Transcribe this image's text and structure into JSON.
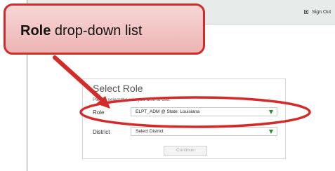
{
  "header": {
    "signout_label": "Sign Out"
  },
  "select_role": {
    "title": "Select Role",
    "instruction": "Please select the role you wish to use.",
    "role_label": "Role",
    "role_value": "ELPT_ADM @ State: Louisiana",
    "district_label": "District",
    "district_value": "Select District",
    "continue_label": "Continue"
  },
  "callout": {
    "bold_text": "Role",
    "text": " drop-down list"
  },
  "colors": {
    "annotation_red": "#d42a2a",
    "caret_green": "#2e8b3a",
    "callout_fill": "#f2c4c4"
  }
}
